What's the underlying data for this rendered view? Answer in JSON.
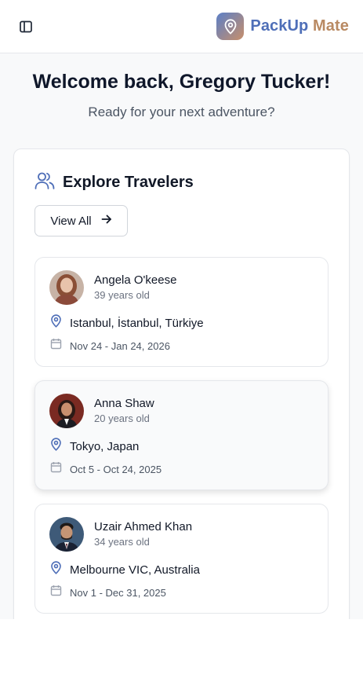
{
  "header": {
    "brand_part1": "PackUp",
    "brand_part2": "Mate",
    "icons": {
      "sidebar": "sidebar-toggle-icon",
      "logo": "map-pin-icon"
    }
  },
  "welcome": {
    "title": "Welcome back, Gregory Tucker!",
    "subtitle": "Ready for your next adventure?"
  },
  "explore": {
    "title": "Explore Travelers",
    "view_all_label": "View All",
    "travelers": [
      {
        "name": "Angela O'keese",
        "age": "39 years old",
        "location": "Istanbul, İstanbul, Türkiye",
        "dates": "Nov 24 - Jan 24, 2026"
      },
      {
        "name": "Anna Shaw",
        "age": "20 years old",
        "location": "Tokyo, Japan",
        "dates": "Oct 5 - Oct 24, 2025"
      },
      {
        "name": "Uzair Ahmed Khan",
        "age": "34 years old",
        "location": "Melbourne VIC, Australia",
        "dates": "Nov 1 - Dec 31, 2025"
      }
    ]
  },
  "colors": {
    "brand_blue": "#4f6fb8",
    "brand_tan": "#b98a63",
    "icon_blue": "#4f6fb8",
    "icon_gray": "#9ca3af"
  }
}
